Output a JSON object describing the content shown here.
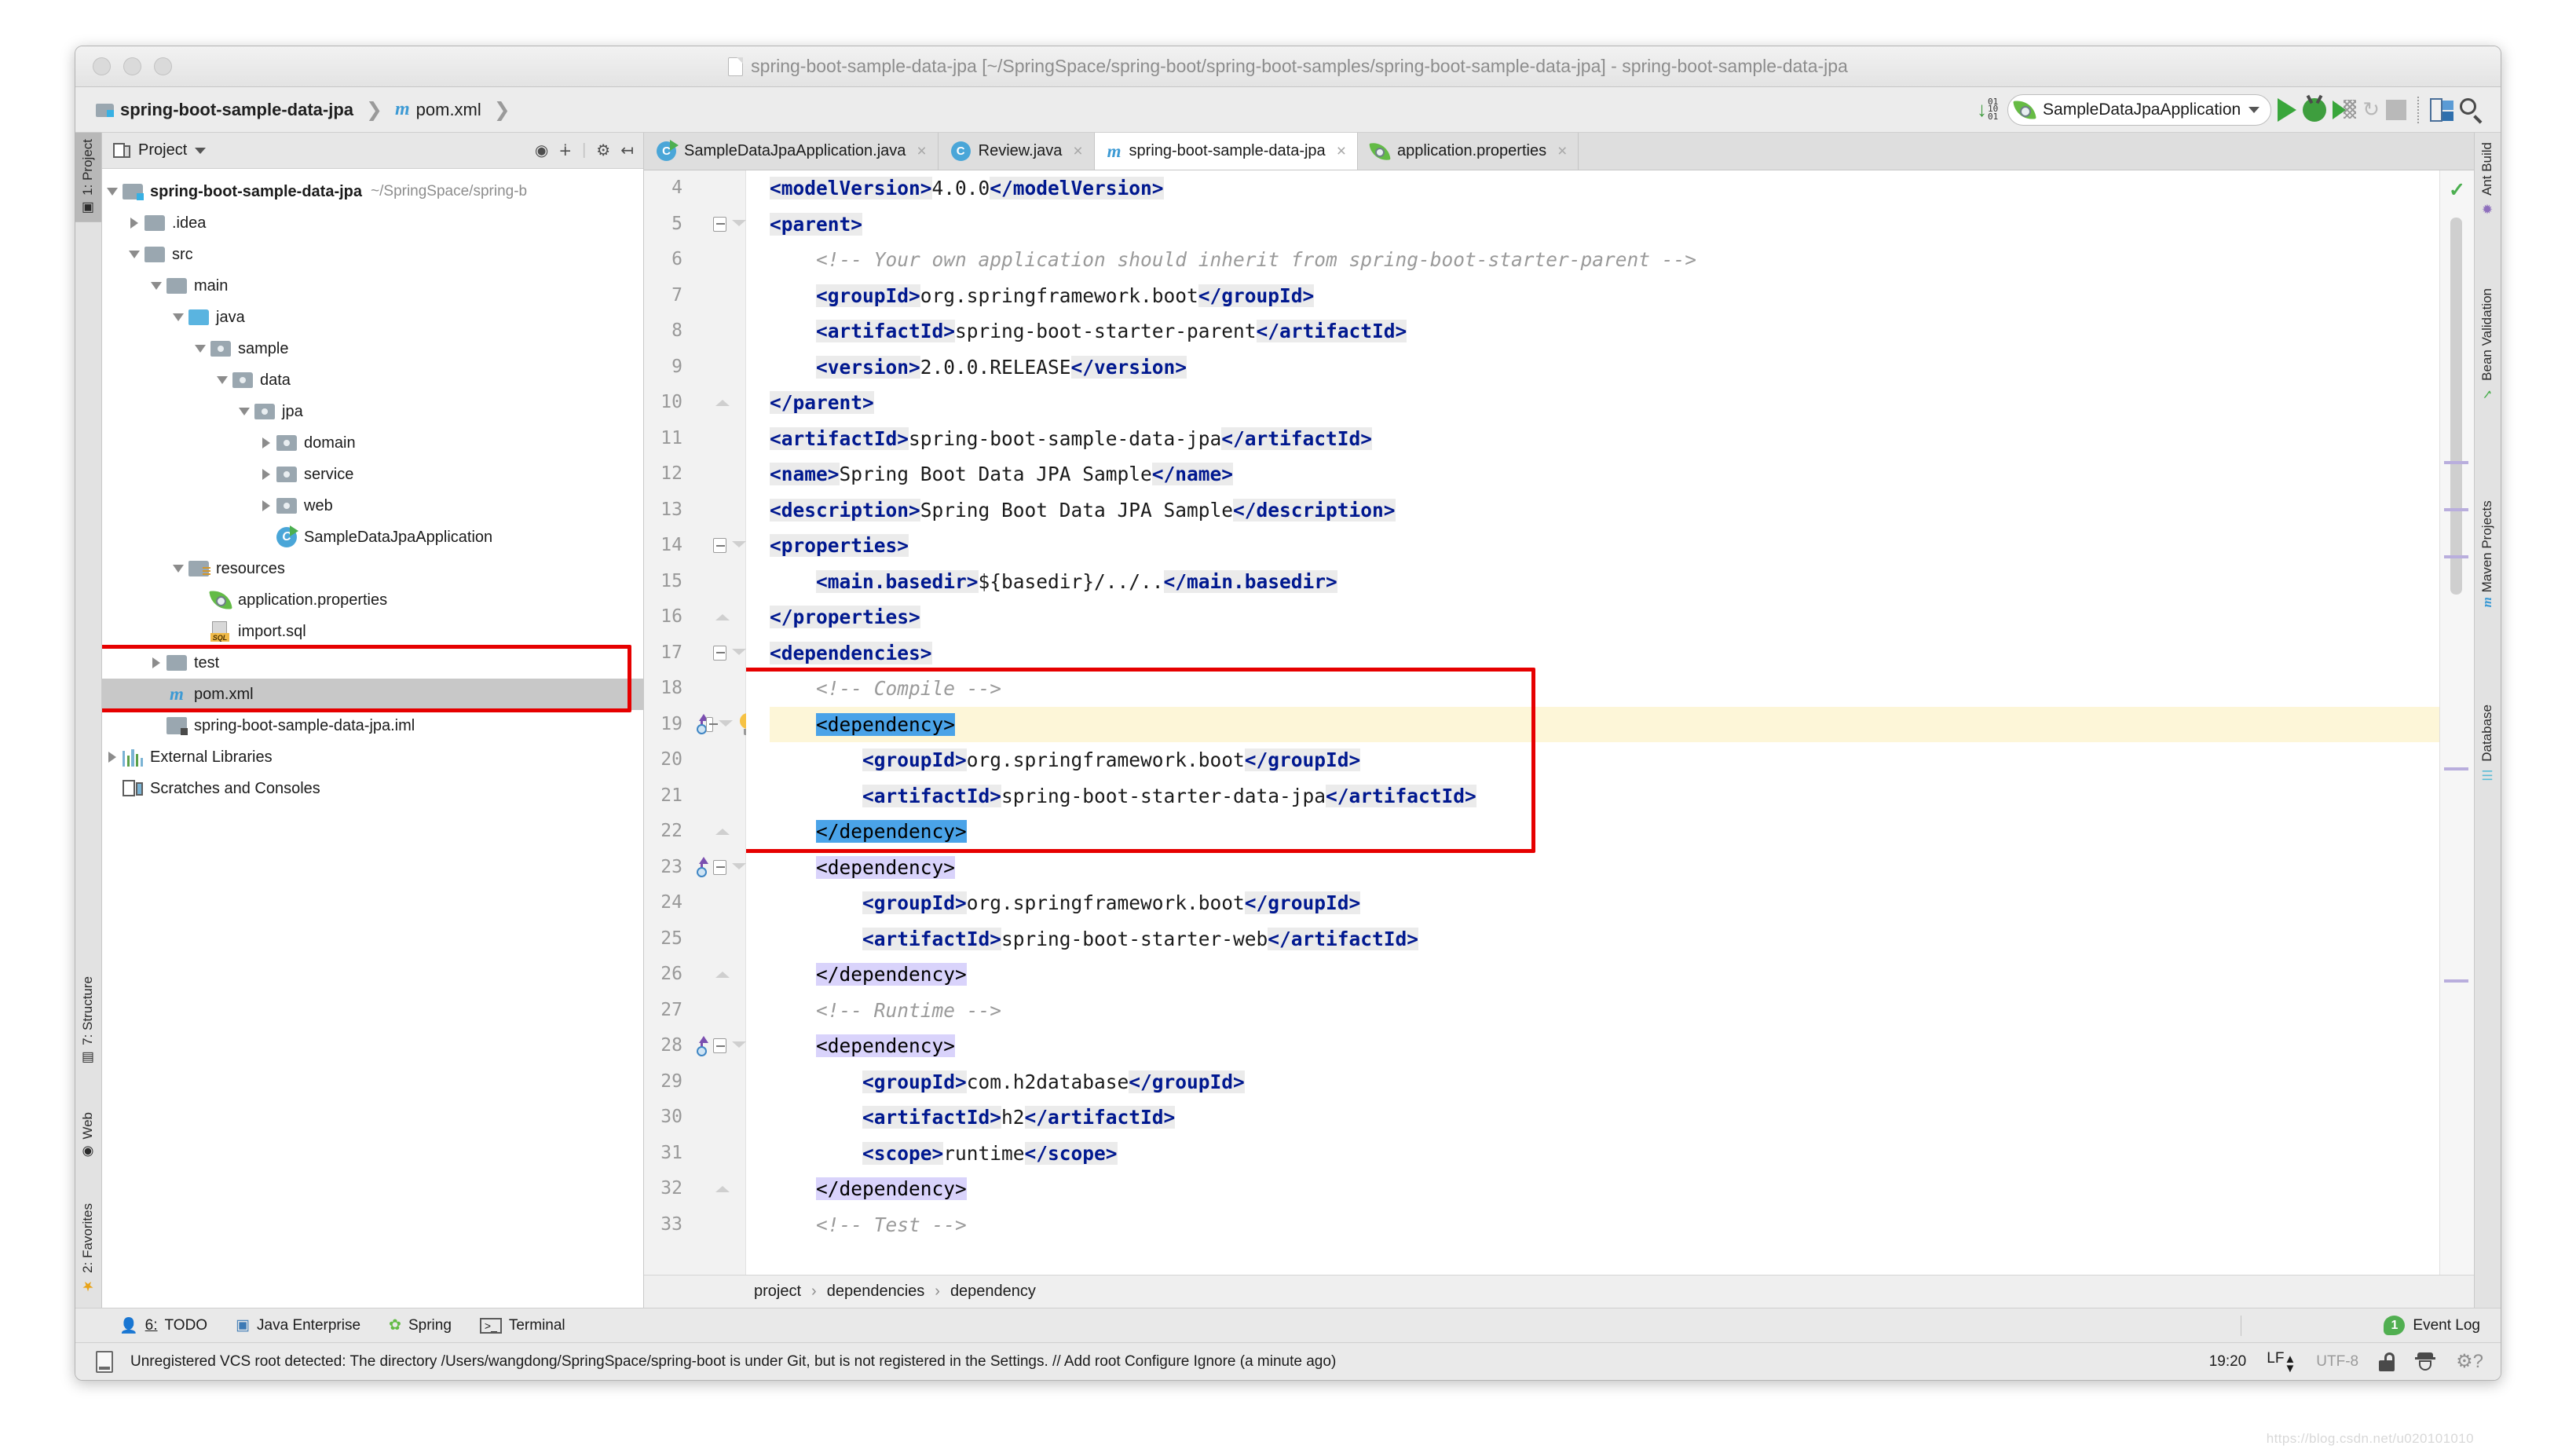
{
  "window": {
    "title": "spring-boot-sample-data-jpa [~/SpringSpace/spring-boot/spring-boot-samples/spring-boot-sample-data-jpa] - spring-boot-sample-data-jpa"
  },
  "navbar": {
    "crumb_project": "spring-boot-sample-data-jpa",
    "crumb_file": "pom.xml",
    "sep": "❯",
    "run_config": "SampleDataJpaApplication",
    "icons": {
      "download": "download-icon",
      "run": "run-icon",
      "debug": "debug-icon",
      "coverage": "run-with-coverage-icon",
      "rerun": "rerun-icon",
      "stop": "stop-icon",
      "layout": "layout-icon",
      "search": "search-everywhere-icon"
    }
  },
  "left_strip": {
    "tabs": [
      {
        "label": "1: Project",
        "active": true,
        "icon": "project-icon"
      },
      {
        "label": "7: Structure",
        "active": false,
        "icon": "structure-icon"
      },
      {
        "label": "Web",
        "active": false,
        "icon": "web-icon"
      },
      {
        "label": "2: Favorites",
        "active": false,
        "icon": "favorites-star-icon"
      }
    ]
  },
  "right_strip": {
    "tabs": [
      {
        "label": "Ant Build",
        "icon": "ant-icon"
      },
      {
        "label": "Bean Validation",
        "icon": "bean-validation-icon"
      },
      {
        "label": "Maven Projects",
        "icon": "maven-m-icon"
      },
      {
        "label": "Database",
        "icon": "database-icon"
      }
    ]
  },
  "project_panel": {
    "title": "Project",
    "header_icons": [
      "locate-icon",
      "collapse-all-icon",
      "settings-gear-icon",
      "hide-icon"
    ],
    "tree": [
      {
        "indent": 0,
        "toggle": "down",
        "icon": "module-folder",
        "label": "spring-boot-sample-data-jpa",
        "bold": true,
        "path": "~/SpringSpace/spring-b"
      },
      {
        "indent": 1,
        "toggle": "right",
        "icon": "folder",
        "label": ".idea"
      },
      {
        "indent": 1,
        "toggle": "down",
        "icon": "folder",
        "label": "src"
      },
      {
        "indent": 2,
        "toggle": "down",
        "icon": "folder",
        "label": "main"
      },
      {
        "indent": 3,
        "toggle": "down",
        "icon": "source-folder",
        "label": "java"
      },
      {
        "indent": 4,
        "toggle": "down",
        "icon": "package-folder",
        "label": "sample"
      },
      {
        "indent": 5,
        "toggle": "down",
        "icon": "package-folder",
        "label": "data"
      },
      {
        "indent": 6,
        "toggle": "down",
        "icon": "package-folder",
        "label": "jpa"
      },
      {
        "indent": 7,
        "toggle": "right",
        "icon": "package-folder",
        "label": "domain"
      },
      {
        "indent": 7,
        "toggle": "right",
        "icon": "package-folder",
        "label": "service"
      },
      {
        "indent": 7,
        "toggle": "right",
        "icon": "package-folder",
        "label": "web"
      },
      {
        "indent": 7,
        "toggle": "none",
        "icon": "spring-class",
        "label": "SampleDataJpaApplication"
      },
      {
        "indent": 3,
        "toggle": "down",
        "icon": "resource-folder",
        "label": "resources"
      },
      {
        "indent": 4,
        "toggle": "none",
        "icon": "spring-file",
        "label": "application.properties"
      },
      {
        "indent": 4,
        "toggle": "none",
        "icon": "sql-file",
        "label": "import.sql"
      },
      {
        "indent": 2,
        "toggle": "right",
        "icon": "test-folder",
        "label": "test"
      },
      {
        "indent": 2,
        "toggle": "none",
        "icon": "maven-file",
        "label": "pom.xml",
        "selected": true
      },
      {
        "indent": 2,
        "toggle": "none",
        "icon": "iml-file",
        "label": "spring-boot-sample-data-jpa.iml"
      },
      {
        "indent": 0,
        "toggle": "right",
        "icon": "external-libs",
        "label": "External Libraries"
      },
      {
        "indent": 0,
        "toggle": "none",
        "icon": "scratches",
        "label": "Scratches and Consoles"
      }
    ],
    "highlight_note": "red-box-around-test-and-pom-xml"
  },
  "editor": {
    "tabs": [
      {
        "label": "SampleDataJpaApplication.java",
        "icon": "spring-class-icon",
        "active": false,
        "close": "×"
      },
      {
        "label": "Review.java",
        "icon": "class-icon",
        "active": false,
        "close": "×"
      },
      {
        "label": "spring-boot-sample-data-jpa",
        "icon": "maven-m-icon",
        "active": true,
        "close": "×"
      },
      {
        "label": "application.properties",
        "icon": "spring-file-icon",
        "active": false,
        "close": "×"
      }
    ],
    "first_line": 4,
    "lines": [
      {
        "n": 4,
        "indent": 0,
        "fold": "none",
        "gutter": "",
        "parts": [
          {
            "t": "tag",
            "v": "<modelVersion>"
          },
          {
            "t": "txt",
            "v": "4.0.0"
          },
          {
            "t": "tag",
            "v": "</modelVersion>"
          }
        ]
      },
      {
        "n": 5,
        "indent": 0,
        "fold": "open",
        "gutter": "",
        "parts": [
          {
            "t": "tag",
            "v": "<parent>"
          }
        ]
      },
      {
        "n": 6,
        "indent": 1,
        "fold": "none",
        "gutter": "",
        "parts": [
          {
            "t": "cmt",
            "v": "<!-- Your own application should inherit from spring-boot-starter-parent -->"
          }
        ]
      },
      {
        "n": 7,
        "indent": 1,
        "fold": "none",
        "gutter": "",
        "parts": [
          {
            "t": "tag",
            "v": "<groupId>"
          },
          {
            "t": "txt",
            "v": "org.springframework.boot"
          },
          {
            "t": "tag",
            "v": "</groupId>"
          }
        ]
      },
      {
        "n": 8,
        "indent": 1,
        "fold": "none",
        "gutter": "",
        "parts": [
          {
            "t": "tag",
            "v": "<artifactId>"
          },
          {
            "t": "txt",
            "v": "spring-boot-starter-parent"
          },
          {
            "t": "tag",
            "v": "</artifactId>"
          }
        ]
      },
      {
        "n": 9,
        "indent": 1,
        "fold": "none",
        "gutter": "",
        "parts": [
          {
            "t": "tag",
            "v": "<version>"
          },
          {
            "t": "txt",
            "v": "2.0.0.RELEASE"
          },
          {
            "t": "tag",
            "v": "</version>"
          }
        ]
      },
      {
        "n": 10,
        "indent": 0,
        "fold": "close",
        "gutter": "",
        "parts": [
          {
            "t": "tag",
            "v": "</parent>"
          }
        ]
      },
      {
        "n": 11,
        "indent": 0,
        "fold": "none",
        "gutter": "",
        "parts": [
          {
            "t": "tag",
            "v": "<artifactId>"
          },
          {
            "t": "txt",
            "v": "spring-boot-sample-data-jpa"
          },
          {
            "t": "tag",
            "v": "</artifactId>"
          }
        ]
      },
      {
        "n": 12,
        "indent": 0,
        "fold": "none",
        "gutter": "",
        "parts": [
          {
            "t": "tag",
            "v": "<name>"
          },
          {
            "t": "txt",
            "v": "Spring Boot Data JPA Sample"
          },
          {
            "t": "tag",
            "v": "</name>"
          }
        ]
      },
      {
        "n": 13,
        "indent": 0,
        "fold": "none",
        "gutter": "",
        "parts": [
          {
            "t": "tag",
            "v": "<description>"
          },
          {
            "t": "txt",
            "v": "Spring Boot Data JPA Sample"
          },
          {
            "t": "tag",
            "v": "</description>"
          }
        ]
      },
      {
        "n": 14,
        "indent": 0,
        "fold": "open",
        "gutter": "",
        "parts": [
          {
            "t": "tag",
            "v": "<properties>"
          }
        ]
      },
      {
        "n": 15,
        "indent": 1,
        "fold": "none",
        "gutter": "",
        "parts": [
          {
            "t": "tag",
            "v": "<main.basedir>"
          },
          {
            "t": "txt",
            "v": "${basedir}/../.."
          },
          {
            "t": "tag",
            "v": "</main.basedir>"
          }
        ]
      },
      {
        "n": 16,
        "indent": 0,
        "fold": "close",
        "gutter": "",
        "parts": [
          {
            "t": "tag",
            "v": "</properties>"
          }
        ]
      },
      {
        "n": 17,
        "indent": 0,
        "fold": "open",
        "gutter": "",
        "parts": [
          {
            "t": "tag",
            "v": "<dependencies>"
          }
        ]
      },
      {
        "n": 18,
        "indent": 1,
        "fold": "none",
        "gutter": "",
        "parts": [
          {
            "t": "cmt",
            "v": "<!-- Compile -->"
          }
        ]
      },
      {
        "n": 19,
        "indent": 1,
        "fold": "open",
        "gutter": "override+bulb",
        "caret": true,
        "parts": [
          {
            "t": "sel",
            "v": "<"
          },
          {
            "t": "pair",
            "v": "dependency"
          },
          {
            "t": "sel",
            "v": ">"
          }
        ]
      },
      {
        "n": 20,
        "indent": 2,
        "fold": "none",
        "gutter": "",
        "parts": [
          {
            "t": "tag",
            "v": "<groupId>"
          },
          {
            "t": "txt",
            "v": "org.springframework.boot"
          },
          {
            "t": "tag",
            "v": "</groupId>"
          }
        ]
      },
      {
        "n": 21,
        "indent": 2,
        "fold": "none",
        "gutter": "",
        "parts": [
          {
            "t": "tag",
            "v": "<artifactId>"
          },
          {
            "t": "txt",
            "v": "spring-boot-starter-data-jpa"
          },
          {
            "t": "tag",
            "v": "</artifactId>"
          }
        ]
      },
      {
        "n": 22,
        "indent": 1,
        "fold": "close",
        "gutter": "",
        "parts": [
          {
            "t": "sel",
            "v": "</"
          },
          {
            "t": "pair",
            "v": "dependency"
          },
          {
            "t": "sel",
            "v": ">"
          }
        ]
      },
      {
        "n": 23,
        "indent": 1,
        "fold": "open",
        "gutter": "override",
        "parts": [
          {
            "t": "pairtag",
            "v": "<dependency>"
          }
        ]
      },
      {
        "n": 24,
        "indent": 2,
        "fold": "none",
        "gutter": "",
        "parts": [
          {
            "t": "tag",
            "v": "<groupId>"
          },
          {
            "t": "txt",
            "v": "org.springframework.boot"
          },
          {
            "t": "tag",
            "v": "</groupId>"
          }
        ]
      },
      {
        "n": 25,
        "indent": 2,
        "fold": "none",
        "gutter": "",
        "parts": [
          {
            "t": "tag",
            "v": "<artifactId>"
          },
          {
            "t": "txt",
            "v": "spring-boot-starter-web"
          },
          {
            "t": "tag",
            "v": "</artifactId>"
          }
        ]
      },
      {
        "n": 26,
        "indent": 1,
        "fold": "close",
        "gutter": "",
        "parts": [
          {
            "t": "pairtag",
            "v": "</dependency>"
          }
        ]
      },
      {
        "n": 27,
        "indent": 1,
        "fold": "none",
        "gutter": "",
        "parts": [
          {
            "t": "cmt",
            "v": "<!-- Runtime -->"
          }
        ]
      },
      {
        "n": 28,
        "indent": 1,
        "fold": "open",
        "gutter": "override",
        "parts": [
          {
            "t": "pairtag",
            "v": "<dependency>"
          }
        ]
      },
      {
        "n": 29,
        "indent": 2,
        "fold": "none",
        "gutter": "",
        "parts": [
          {
            "t": "tag",
            "v": "<groupId>"
          },
          {
            "t": "txt",
            "v": "com.h2database"
          },
          {
            "t": "tag",
            "v": "</groupId>"
          }
        ]
      },
      {
        "n": 30,
        "indent": 2,
        "fold": "none",
        "gutter": "",
        "parts": [
          {
            "t": "tag",
            "v": "<artifactId>"
          },
          {
            "t": "txt",
            "v": "h2"
          },
          {
            "t": "tag",
            "v": "</artifactId>"
          }
        ]
      },
      {
        "n": 31,
        "indent": 2,
        "fold": "none",
        "gutter": "",
        "parts": [
          {
            "t": "tag",
            "v": "<scope>"
          },
          {
            "t": "txt",
            "v": "runtime"
          },
          {
            "t": "tag",
            "v": "</scope>"
          }
        ]
      },
      {
        "n": 32,
        "indent": 1,
        "fold": "close",
        "gutter": "",
        "parts": [
          {
            "t": "pairtag",
            "v": "</dependency>"
          }
        ]
      },
      {
        "n": 33,
        "indent": 1,
        "fold": "none",
        "gutter": "",
        "parts": [
          {
            "t": "cmt",
            "v": "<!-- Test -->"
          }
        ]
      }
    ],
    "breadcrumb": [
      "project",
      "dependencies",
      "dependency"
    ],
    "breadcrumb_sep": "›",
    "inspection_ok": "✓",
    "highlight_note": "red-box-around-compile-dependency-block-lines-18-22"
  },
  "toolwindow_bar": {
    "items": [
      {
        "num": "6:",
        "label": " TODO",
        "icon": "todo-icon"
      },
      {
        "num": "",
        "label": "Java Enterprise",
        "icon": "java-enterprise-icon"
      },
      {
        "num": "",
        "label": "Spring",
        "icon": "spring-leaf-icon"
      },
      {
        "num": "",
        "label": "Terminal",
        "icon": "terminal-icon"
      }
    ],
    "event_log": {
      "count": "1",
      "label": "Event Log"
    }
  },
  "statusbar": {
    "message": "Unregistered VCS root detected: The directory /Users/wangdong/SpringSpace/spring-boot is under Git, but is not registered in the Settings. // Add root  Configure  Ignore (a minute ago)",
    "time": "19:20",
    "line_sep": "LF",
    "encoding": "UTF-8",
    "icons": [
      "lock-icon",
      "inspector-hat-icon",
      "gear-question-icon"
    ]
  },
  "colors": {
    "accent_red_box": "#e60000",
    "tag_blue": "#00188f",
    "comment_gray": "#9a9a9a",
    "caret_line": "#fdf6d8",
    "selection_blue": "#4aa3e8",
    "pair_highlight": "#d9d3fb",
    "selected_row": "#c8c8c8"
  },
  "watermark": "https://blog.csdn.net/u020101010"
}
